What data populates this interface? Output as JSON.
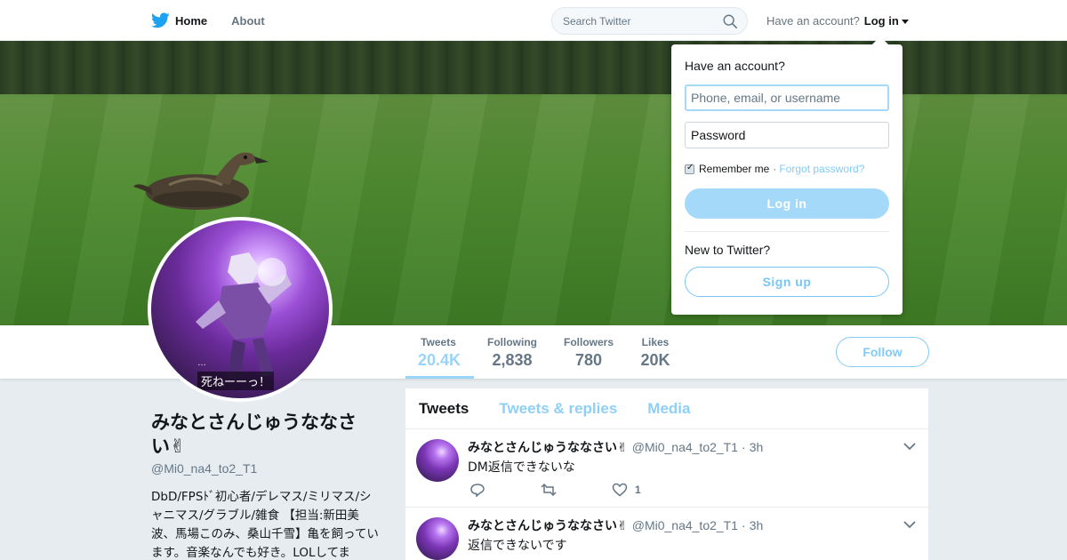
{
  "nav": {
    "home_label": "Home",
    "about_label": "About",
    "search_placeholder": "Search Twitter",
    "account_prompt": "Have an account?",
    "login_label": "Log in"
  },
  "profile": {
    "name": "みなとさんじゅうななさい✌",
    "handle": "@Mi0_na4_to2_T1",
    "bio": "DbD/FPSﾄﾞ初心者/デレマス/ミリマス/シャニマス/グラブル/雑食 【担当:新田美波、馬場このみ、桑山千雪】亀を飼っています。音楽なんでも好き。LOLしてま",
    "avatar_caption": "死ねーーっ！",
    "avatar_caption_mark": "…"
  },
  "stats": [
    {
      "label": "Tweets",
      "value": "20.4K"
    },
    {
      "label": "Following",
      "value": "2,838"
    },
    {
      "label": "Followers",
      "value": "780"
    },
    {
      "label": "Likes",
      "value": "20K"
    }
  ],
  "follow_label": "Follow",
  "tabs": [
    "Tweets",
    "Tweets & replies",
    "Media"
  ],
  "tweets": [
    {
      "name": "みなとさんじゅうななさい✌",
      "handle": "@Mi0_na4_to2_T1",
      "time": "3h",
      "text": "DM返信できないな",
      "likes": "1"
    },
    {
      "name": "みなとさんじゅうななさい✌",
      "handle": "@Mi0_na4_to2_T1",
      "time": "3h",
      "text": "返信できないです",
      "likes": ""
    }
  ],
  "login_dropdown": {
    "title": "Have an account?",
    "username_placeholder": "Phone, email, or username",
    "password_placeholder": "Password",
    "remember_label": "Remember me",
    "forgot_label": "Forgot password?",
    "login_button": "Log in",
    "new_prompt": "New to Twitter?",
    "signup_button": "Sign up"
  },
  "colors": {
    "accent": "#1da1f2",
    "background": "#e6ecf0",
    "text": "#14171a",
    "muted": "#657786"
  }
}
